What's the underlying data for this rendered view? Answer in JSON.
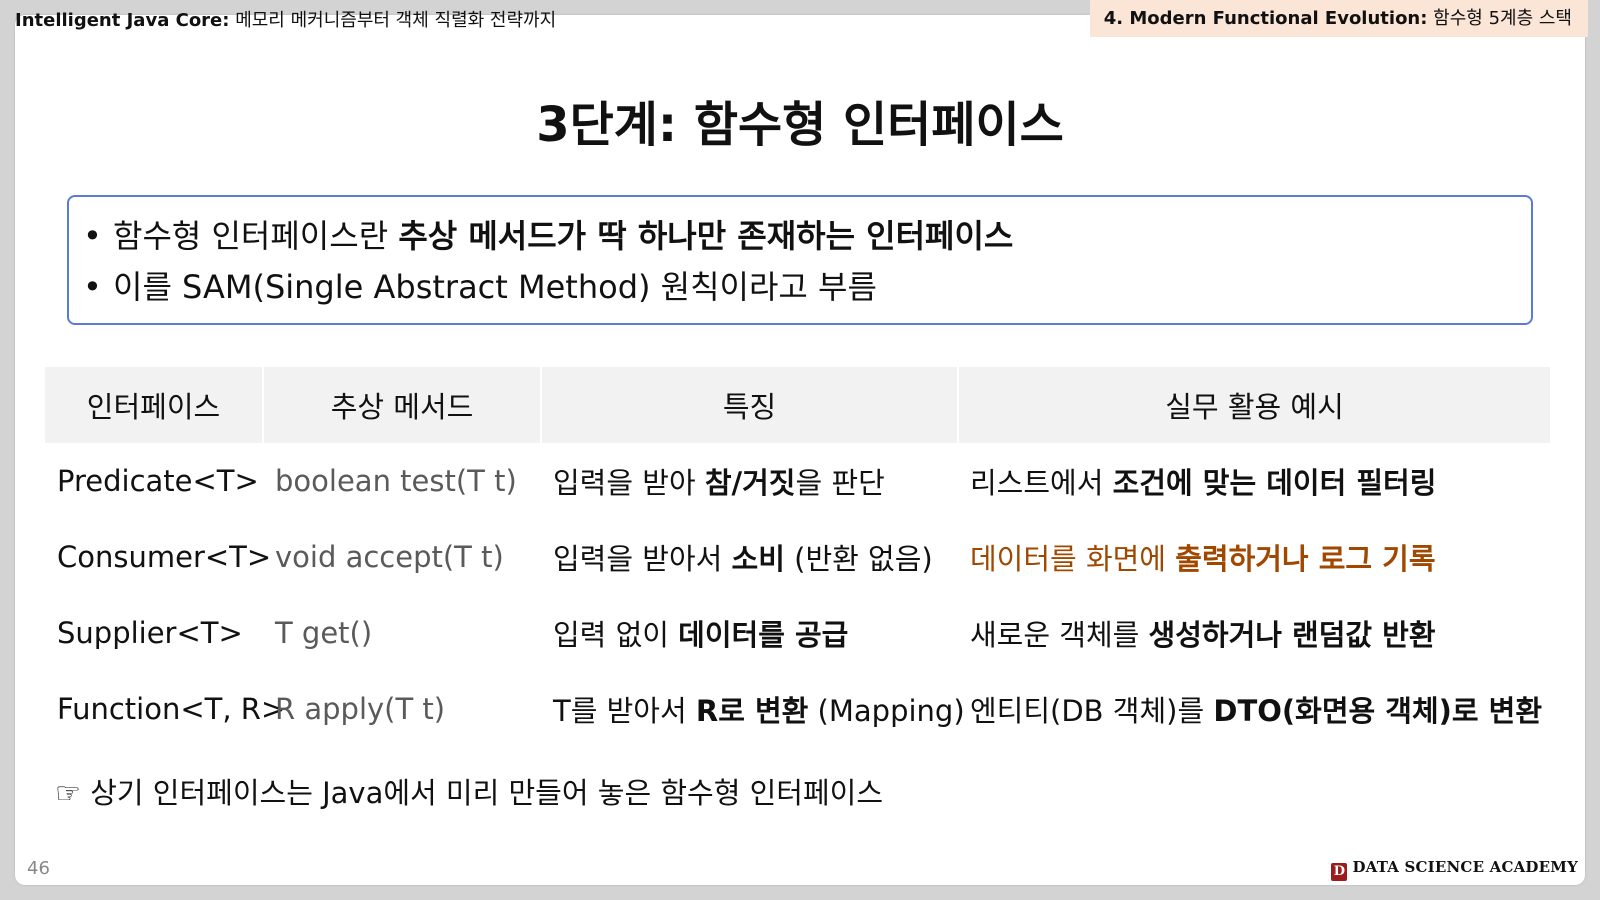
{
  "header": {
    "course_bold": "Intelligent Java Core:",
    "course_rest": " 메모리 메커니즘부터 객체 직렬화 전략까지",
    "section_bold": "4. Modern Functional Evolution:",
    "section_rest": " 함수형 5계층 스택"
  },
  "title": {
    "prefix": "3단계:",
    "text": " 함수형 인터페이스"
  },
  "bullets": [
    {
      "dot": "•",
      "pre": "함수형 인터페이스란 ",
      "bold": "추상 메서드가 딱 하나만 존재하는 인터페이스",
      "post": ""
    },
    {
      "dot": "•",
      "pre": "이를 SAM(Single Abstract Method) 원칙이라고 부름",
      "bold": "",
      "post": ""
    }
  ],
  "table": {
    "headers": [
      "인터페이스",
      "추상 메서드",
      "특징",
      "실무 활용 예시"
    ],
    "rows": [
      {
        "name": "Predicate<T>",
        "method": "boolean test(T t)",
        "feature_pre": "입력을 받아 ",
        "feature_bold": "참/거짓",
        "feature_post": "을 판단",
        "usage_pre": "리스트에서 ",
        "usage_bold": "조건에 맞는 데이터 필터링",
        "usage_post": "",
        "usage_color": ""
      },
      {
        "name": "Consumer<T>",
        "method": "void accept(T t)",
        "feature_pre": "입력을 받아서 ",
        "feature_bold": "소비",
        "feature_post": " (반환 없음)",
        "usage_pre": "데이터를 화면에 ",
        "usage_bold": "출력하거나 로그 기록",
        "usage_post": "",
        "usage_color": "#a04800"
      },
      {
        "name": "Supplier<T>",
        "method": "T get()",
        "feature_pre": "입력 없이 ",
        "feature_bold": "데이터를 공급",
        "feature_post": "",
        "usage_pre": "새로운 객체를 ",
        "usage_bold": "생성하거나 랜덤값 반환",
        "usage_post": "",
        "usage_color": ""
      },
      {
        "name": "Function<T, R>",
        "method": "R apply(T t)",
        "feature_pre": "T를 받아서 ",
        "feature_bold": "R로 변환",
        "feature_post": " (Mapping)",
        "usage_pre": "엔티티(DB 객체)를 ",
        "usage_bold": "DTO(화면용 객체)로 변환",
        "usage_post": "",
        "usage_color": ""
      }
    ]
  },
  "note": "☞ 상기 인터페이스는 Java에서 미리 만들어 놓은 함수형 인터페이스",
  "footer": {
    "page_number": "46",
    "logo_letter": "D",
    "brand": "DATA SCIENCE ACADEMY"
  },
  "colors": {
    "accent_border": "#5b7bd6",
    "header_tag_bg": "#fbe5d6",
    "highlight_text": "#a04800",
    "table_header_bg": "#f2f2f2"
  }
}
